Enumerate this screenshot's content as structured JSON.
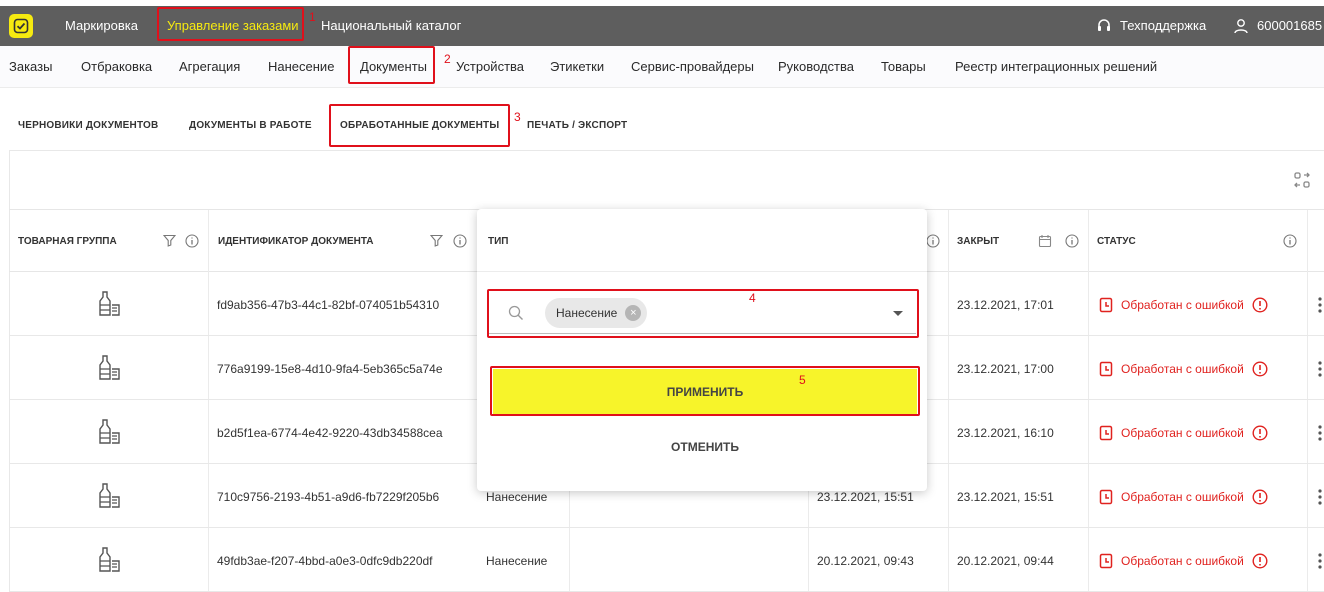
{
  "topbar": {
    "nav": [
      "Маркировка",
      "Управление заказами",
      "Национальный каталог"
    ],
    "support_label": "Техподдержка",
    "account_id": "600001685",
    "accent_color": "#f6ea10"
  },
  "subnav": {
    "items": [
      "Заказы",
      "Отбраковка",
      "Агрегация",
      "Нанесение",
      "Документы",
      "Устройства",
      "Этикетки",
      "Сервис-провайдеры",
      "Руководства",
      "Товары",
      "Реестр интеграционных решений"
    ]
  },
  "doc_tabs": [
    "Черновики документов",
    "Документы в работе",
    "Обработанные документы",
    "Печать / экспорт"
  ],
  "table": {
    "headers": [
      "Товарная группа",
      "Идентификатор документа",
      "Тип",
      "Закрыт",
      "Статус"
    ],
    "rows": [
      {
        "id": "fd9ab356-47b3-44c1-82bf-074051b54310",
        "type": "",
        "created": "",
        "closed": "23.12.2021, 17:01",
        "status": "Обработан с ошибкой"
      },
      {
        "id": "776a9199-15e8-4d10-9fa4-5eb365c5a74e",
        "type": "",
        "created": "",
        "closed": "23.12.2021, 17:00",
        "status": "Обработан с ошибкой"
      },
      {
        "id": "b2d5f1ea-6774-4e42-9220-43db34588cea",
        "type": "",
        "created": "",
        "closed": "23.12.2021, 16:10",
        "status": "Обработан с ошибкой"
      },
      {
        "id": "710c9756-2193-4b51-a9d6-fb7229f205b6",
        "type": "Нанесение",
        "created": "23.12.2021, 15:51",
        "closed": "23.12.2021, 15:51",
        "status": "Обработан с ошибкой"
      },
      {
        "id": "49fdb3ae-f207-4bbd-a0e3-0dfc9db220df",
        "type": "Нанесение",
        "created": "20.12.2021, 09:43",
        "closed": "20.12.2021, 09:44",
        "status": "Обработан с ошибкой"
      }
    ],
    "status_color": "#e0221f"
  },
  "filter_popup": {
    "title": "Тип",
    "selected_chip": "Нанесение",
    "apply_label": "Применить",
    "cancel_label": "Отменить",
    "apply_color": "#f7f42a"
  },
  "annotations": [
    "1",
    "2",
    "3",
    "4",
    "5"
  ],
  "annotation_color": "#e0101b",
  "icons": [
    "logo-icon",
    "headset-icon",
    "user-icon",
    "filter-icon",
    "info-icon",
    "calendar-icon",
    "settings-icon",
    "bottle-icon",
    "clock-icon",
    "search-icon",
    "chevron-down-icon",
    "more-icon"
  ]
}
